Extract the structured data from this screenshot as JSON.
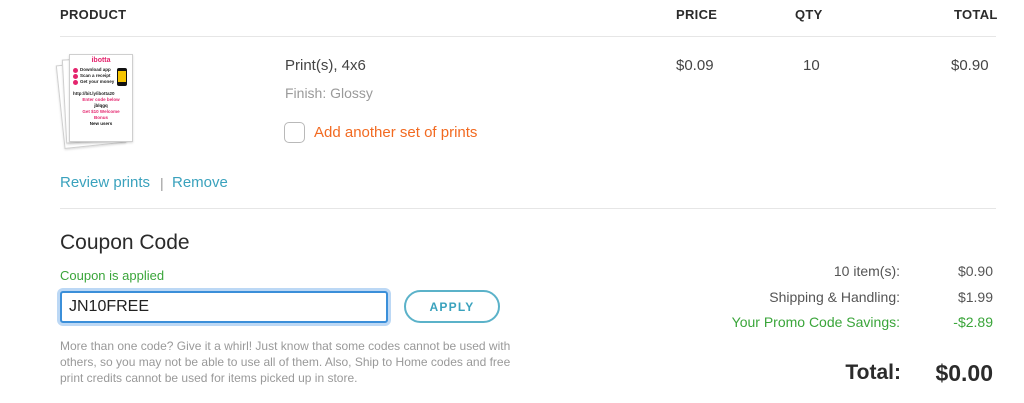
{
  "table": {
    "headers": {
      "product": "PRODUCT",
      "price": "PRICE",
      "qty": "QTY",
      "total": "TOTAL"
    }
  },
  "item": {
    "name": "Print(s), 4x6",
    "finish": "Finish: Glossy",
    "add_prints_label": "Add another set of prints",
    "add_prints_checked": false,
    "price": "$0.09",
    "qty": "10",
    "total": "$0.90",
    "review_link": "Review prints",
    "separator": "|",
    "remove_link": "Remove",
    "thumbnail": {
      "title": "ibotta",
      "steps": [
        "Download app",
        "Scan a receipt",
        "Get your money"
      ],
      "link": "http://bit.ly/ibotta20",
      "line1": "Enter code below",
      "code": "jblqgq",
      "line2": "Get $10 Welcome",
      "line3": "Bonus",
      "line4": "New users"
    }
  },
  "coupon": {
    "title": "Coupon Code",
    "status": "Coupon is applied",
    "value": "JN10FREE",
    "apply_label": "APPLY",
    "note": "More than one code? Give it a whirl! Just know that some codes cannot be used with others, so you may not be able to use all of them. Also, Ship to Home codes and free print credits cannot be used for items picked up in store."
  },
  "summary": {
    "items_label": "10 item(s):",
    "items_value": "$0.90",
    "shipping_label": "Shipping & Handling:",
    "shipping_value": "$1.99",
    "promo_label": "Your Promo Code Savings:",
    "promo_value": "-$2.89",
    "total_label": "Total:",
    "total_value": "$0.00"
  },
  "colors": {
    "link": "#3aa2bd",
    "accent_orange": "#f26a21",
    "success_green": "#3aa53a",
    "input_focus": "#3b8fd9"
  }
}
